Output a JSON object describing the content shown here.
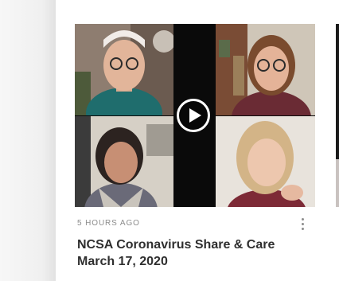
{
  "video_card": {
    "thumbnail": {
      "icon": "play-icon",
      "participants": 4
    },
    "timestamp": "5 HOURS AGO",
    "more_icon": "more-vertical-icon",
    "title_line1": "NCSA Coronavirus Share & Care",
    "title_line2": "March 17, 2020"
  },
  "colors": {
    "title": "#2f2f2f",
    "meta": "#8c8c8c",
    "background": "#ffffff"
  }
}
